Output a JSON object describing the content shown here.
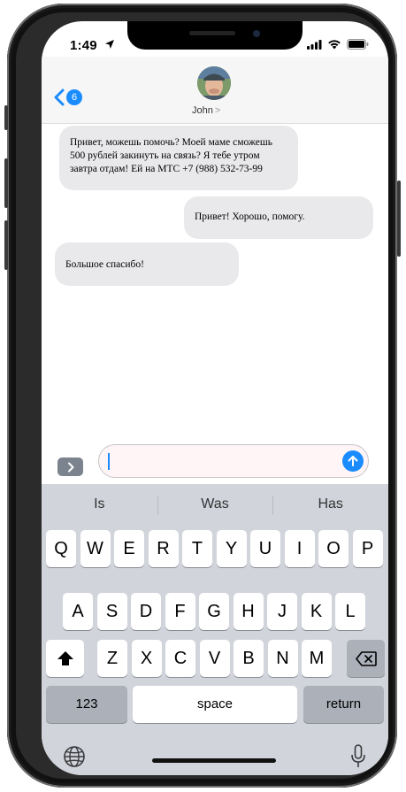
{
  "status": {
    "time": "1:49"
  },
  "header": {
    "back_badge": "6",
    "contact_name": "John",
    "contact_chevron": ">"
  },
  "messages": [
    {
      "direction": "incoming",
      "text": "Привет, можешь помочь? Моей маме сможешь 500 рублей закинуть на связь? Я тебе утром завтра отдам! Ей на МТС +7 (988) 532-73-99"
    },
    {
      "direction": "outgoing",
      "text": "Привет! Хорошо, помогу."
    },
    {
      "direction": "incoming",
      "text": "Большое спасибо!"
    }
  ],
  "input": {
    "value": ""
  },
  "keyboard": {
    "suggestions": [
      "Is",
      "Was",
      "Has"
    ],
    "row1": [
      "Q",
      "W",
      "E",
      "R",
      "T",
      "Y",
      "U",
      "I",
      "O",
      "P"
    ],
    "row2": [
      "A",
      "S",
      "D",
      "F",
      "G",
      "H",
      "J",
      "K",
      "L"
    ],
    "row3": [
      "Z",
      "X",
      "C",
      "V",
      "B",
      "N",
      "M"
    ],
    "numbers_label": "123",
    "space_label": "space",
    "return_label": "return"
  },
  "icons": {
    "location": "location-arrow-icon",
    "signal": "cellular-signal-icon",
    "wifi": "wifi-icon",
    "battery": "battery-icon",
    "back": "chevron-left-icon",
    "apps": "chevron-right-icon",
    "send": "arrow-up-icon",
    "shift": "shift-icon",
    "delete": "delete-icon",
    "globe": "globe-icon",
    "mic": "microphone-icon"
  },
  "colors": {
    "accent": "#1a8cff",
    "bubble": "#e9e9eb",
    "keyboard_bg": "#d1d4db"
  }
}
